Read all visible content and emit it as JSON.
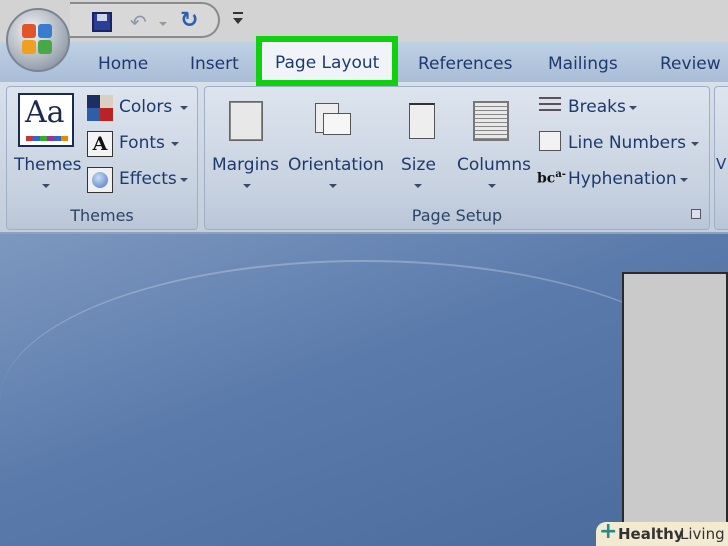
{
  "tabs": [
    {
      "label": "Home"
    },
    {
      "label": "Insert"
    },
    {
      "label": "Page Layout",
      "active": true
    },
    {
      "label": "References"
    },
    {
      "label": "Mailings"
    },
    {
      "label": "Review"
    }
  ],
  "themes_group": {
    "label": "Themes",
    "themes_button": "Themes",
    "colors": "Colors",
    "fonts": "Fonts",
    "effects": "Effects"
  },
  "page_setup_group": {
    "label": "Page Setup",
    "margins": "Margins",
    "orientation": "Orientation",
    "size": "Size",
    "columns": "Columns",
    "breaks": "Breaks",
    "line_numbers": "Line Numbers",
    "hyphenation": "Hyphenation"
  },
  "next_group_partial": "V",
  "watermark": {
    "brand_bold": "Healthy",
    "brand_light": "Living"
  },
  "colors": {
    "highlight": "#10d010",
    "tab_text": "#1d3a6e"
  }
}
